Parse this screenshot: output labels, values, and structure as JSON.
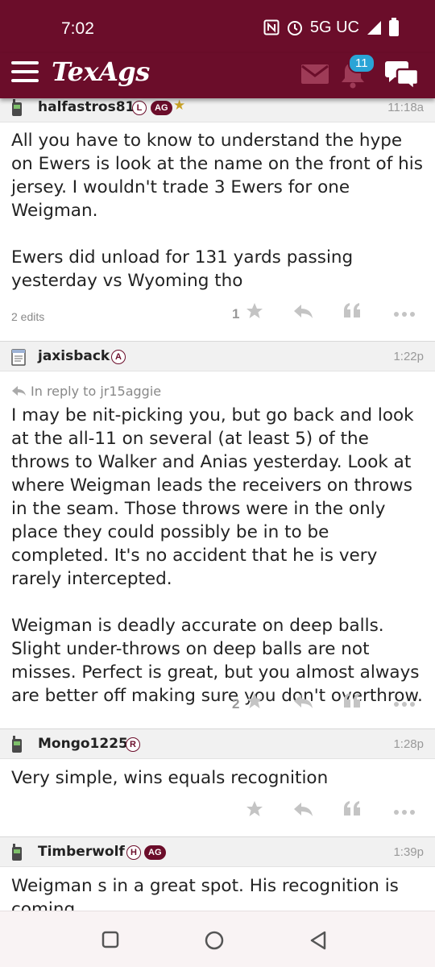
{
  "status_bar": {
    "time": "7:02",
    "network": "5G UC"
  },
  "header": {
    "logo": "TexAgs",
    "notification_count": "11"
  },
  "posts": [
    {
      "username": "halfastros81",
      "badges": [
        "L",
        "AG"
      ],
      "has_star": true,
      "time": "11:18a",
      "body": [
        "All you have to know to understand the hype on Ewers is look at the name on the front of his jersey. I wouldn't trade 3 Ewers for one Weigman.",
        "Ewers did unload for 131 yards passing yesterday vs Wyoming tho"
      ],
      "edits": "2 edits",
      "star_count": "1"
    },
    {
      "username": "jaxisback",
      "badges": [
        "A"
      ],
      "time": "1:22p",
      "reply_to": "In reply to jr15aggie",
      "body": [
        "I may be nit-picking you, but go back and look at the all-11 on several (at least 5) of the throws to Walker and Anias yesterday. Look at where Weigman leads the receivers on throws in the seam. Those throws were in the only place they could possibly be in to be completed. It's no accident that he is very rarely intercepted.",
        "Weigman is deadly accurate on deep balls. Slight under-throws on deep balls are not misses. Perfect is great, but you almost always are better off making sure you don't overthrow."
      ],
      "star_count": "2"
    },
    {
      "username": "Mongo1225",
      "badges": [
        "R"
      ],
      "time": "1:28p",
      "body": [
        "Very simple, wins equals recognition"
      ],
      "star_count": ""
    },
    {
      "username": "Timberwolf",
      "badges": [
        "H",
        "AG"
      ],
      "time": "1:39p",
      "body": [
        "Weigman s in a great spot. His recognition is coming"
      ]
    }
  ],
  "colors": {
    "brand_maroon": "#6b0d2a",
    "badge_blue": "#2aa4d6",
    "star_gold": "#c9a227"
  },
  "icons": [
    "hamburger-icon",
    "mail-icon",
    "bell-icon",
    "chat-icon",
    "phone-icon",
    "notepad-icon",
    "star-icon",
    "reply-icon",
    "quote-icon",
    "more-icon",
    "nav-back-icon",
    "nav-home-icon",
    "nav-recents-icon"
  ]
}
